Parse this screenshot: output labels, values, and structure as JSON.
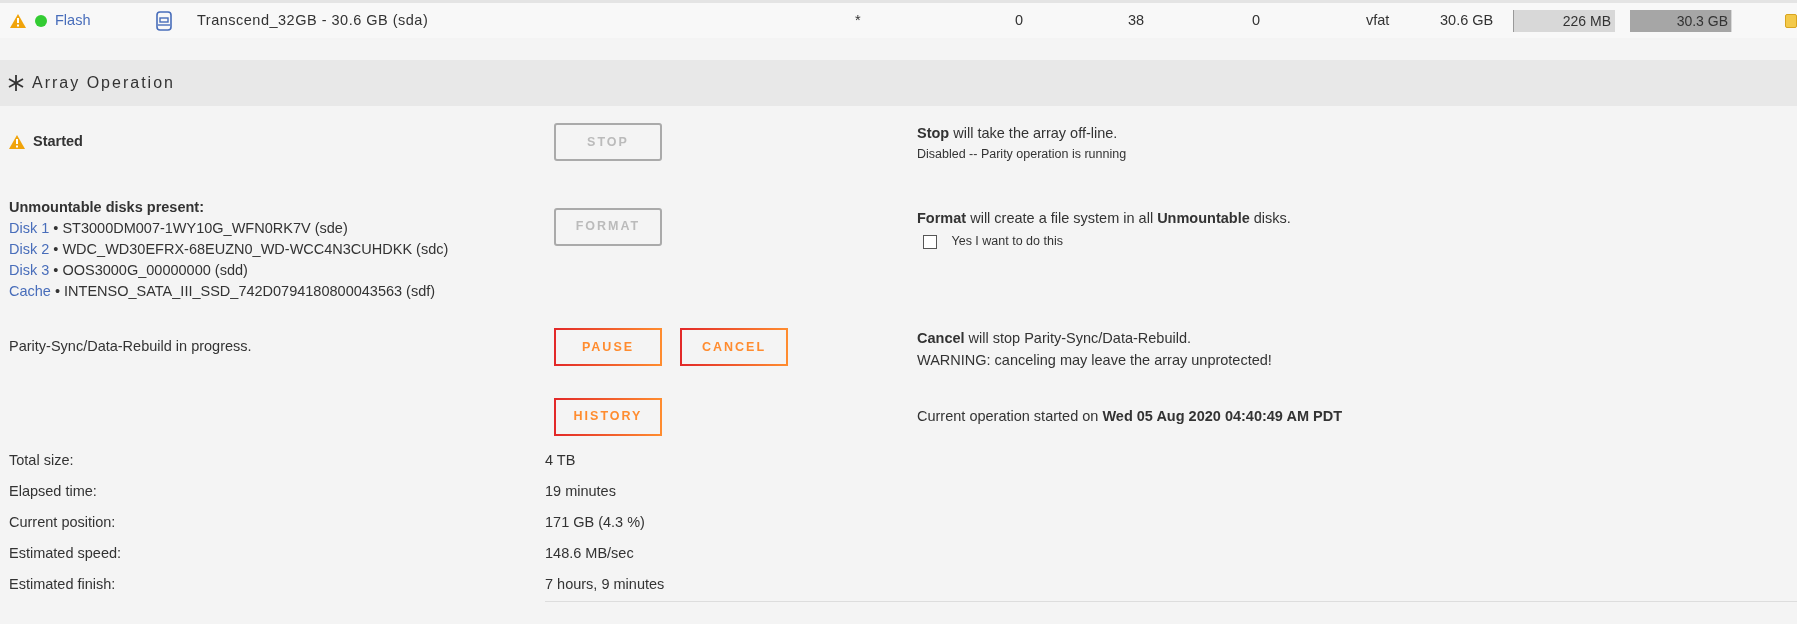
{
  "device_row": {
    "warning": true,
    "online": true,
    "name": "Flash",
    "identification": "Transcend_32GB - 30.6 GB (sda)",
    "temp": "*",
    "reads": "0",
    "writes": "38",
    "errors": "0",
    "fs": "vfat",
    "size": "30.6 GB",
    "used": {
      "text": "226 MB",
      "level": 0.01
    },
    "free": {
      "text": "30.3 GB",
      "level": 0.99
    }
  },
  "section": {
    "title": "Array Operation"
  },
  "status": {
    "label": "Started",
    "warning": true
  },
  "stop": {
    "button": {
      "label": "STOP",
      "disabled": true
    },
    "description": "**Stop** will take the array off-line.",
    "note": "Disabled -- Parity operation is running"
  },
  "unmountable": {
    "title": "Unmountable disks present:",
    "disks": [
      {
        "name": "Disk 1",
        "detail": "• ST3000DM007-1WY10G_WFN0RK7V (sde)"
      },
      {
        "name": "Disk 2",
        "detail": "• WDC_WD30EFRX-68EUZN0_WD-WCC4N3CUHDKK (sdc)"
      },
      {
        "name": "Disk 3",
        "detail": "• OOS3000G_00000000 (sdd)"
      },
      {
        "name": "Cache",
        "detail": "• INTENSO_SATA_III_SSD_742D0794180800043563 (sdf)"
      }
    ],
    "button": {
      "label": "FORMAT",
      "disabled": true
    },
    "description": "**Format** will create a file system in all **Unmountable** disks.",
    "confirm": {
      "label": "Yes I want to do this",
      "checked": false
    }
  },
  "parity": {
    "text": "Parity-Sync/Data-Rebuild in progress.",
    "buttons": [
      {
        "label": "PAUSE",
        "disabled": false
      },
      {
        "label": "CANCEL",
        "disabled": false
      }
    ],
    "lines": [
      "**Cancel** will stop Parity-Sync/Data-Rebuild.",
      "WARNING: canceling may leave the array unprotected!"
    ]
  },
  "history": {
    "button": {
      "label": "HISTORY",
      "disabled": false
    },
    "description": "Current operation started on **Wed 05 Aug 2020 04:40:49 AM PDT**"
  },
  "stats": [
    {
      "label": "Total size:",
      "value": "4 TB"
    },
    {
      "label": "Elapsed time:",
      "value": "19 minutes"
    },
    {
      "label": "Current position:",
      "value": "171 GB (4.3 %)"
    },
    {
      "label": "Estimated speed:",
      "value": "148.6 MB/sec"
    },
    {
      "label": "Estimated finish:",
      "value": "7 hours, 9 minutes"
    }
  ]
}
